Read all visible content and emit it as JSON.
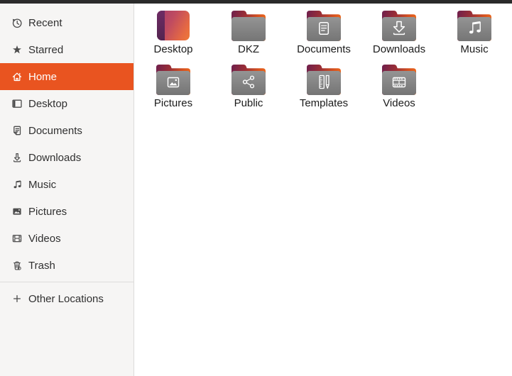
{
  "window": {
    "topbar_color": "#2b2b2b",
    "background": "#ffffff"
  },
  "sidebar": {
    "background": "#f6f5f4",
    "selection_color": "#E95420",
    "items": [
      {
        "label": "Recent",
        "icon": "recent-icon",
        "selected": false
      },
      {
        "label": "Starred",
        "icon": "star-icon",
        "selected": false
      },
      {
        "label": "Home",
        "icon": "home-icon",
        "selected": true
      },
      {
        "label": "Desktop",
        "icon": "desktop-icon",
        "selected": false
      },
      {
        "label": "Documents",
        "icon": "document-icon",
        "selected": false
      },
      {
        "label": "Downloads",
        "icon": "download-icon",
        "selected": false
      },
      {
        "label": "Music",
        "icon": "music-icon",
        "selected": false
      },
      {
        "label": "Pictures",
        "icon": "picture-icon",
        "selected": false
      },
      {
        "label": "Videos",
        "icon": "video-icon",
        "selected": false
      },
      {
        "label": "Trash",
        "icon": "trash-icon",
        "selected": false
      }
    ],
    "footer_item": {
      "label": "Other Locations",
      "icon": "plus-icon"
    }
  },
  "main": {
    "folders": [
      {
        "label": "Desktop",
        "emblem": "desktop-gradient-tile"
      },
      {
        "label": "DKZ",
        "emblem": "plain-folder"
      },
      {
        "label": "Documents",
        "emblem": "document-emblem"
      },
      {
        "label": "Downloads",
        "emblem": "download-arrow-emblem"
      },
      {
        "label": "Music",
        "emblem": "music-note-emblem"
      },
      {
        "label": "Pictures",
        "emblem": "photo-emblem"
      },
      {
        "label": "Public",
        "emblem": "share-emblem"
      },
      {
        "label": "Templates",
        "emblem": "ruler-pencil-emblem"
      },
      {
        "label": "Videos",
        "emblem": "filmstrip-emblem"
      }
    ],
    "folder_colors": {
      "tab_gradient_start": "#6f1f4d",
      "tab_gradient_mid": "#9c2f35",
      "tab_gradient_end": "#ec661a",
      "body_gray_top": "#949494",
      "body_gray_bottom": "#757575"
    }
  }
}
